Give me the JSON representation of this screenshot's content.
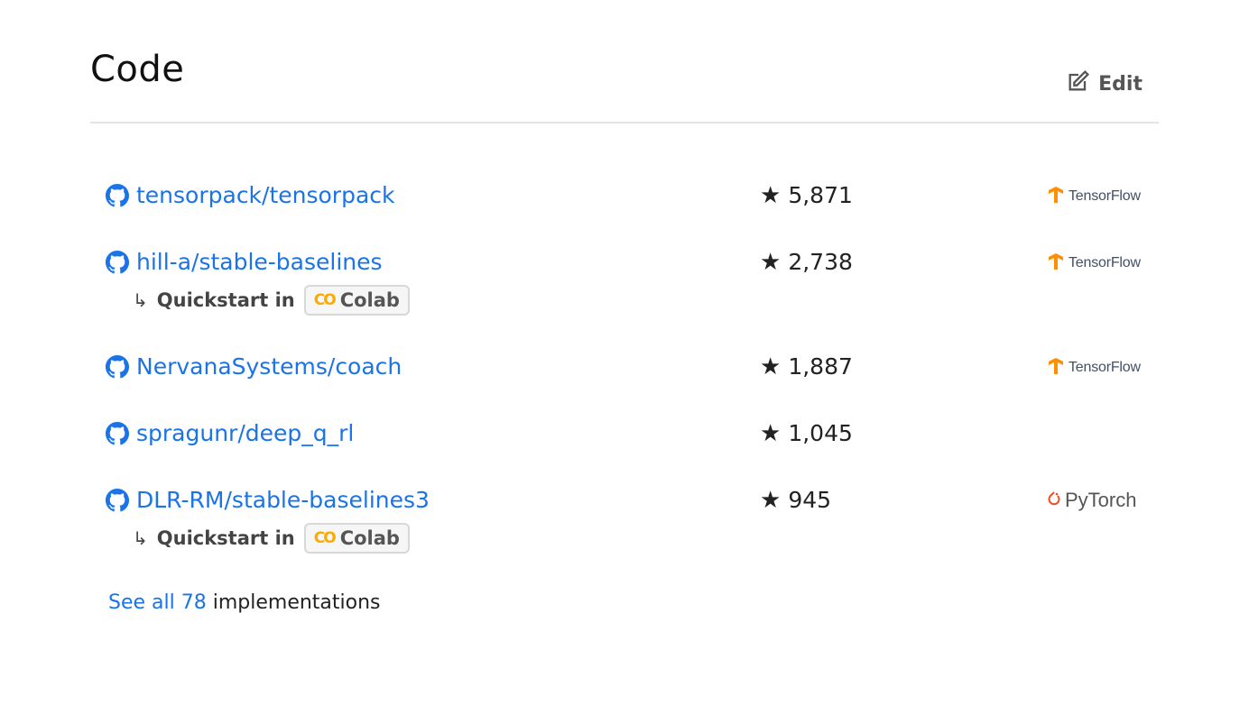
{
  "header": {
    "title": "Code",
    "edit_label": "Edit"
  },
  "rows": [
    {
      "repo": "tensorpack/tensorpack",
      "stars": "5,871",
      "framework": "TensorFlow"
    },
    {
      "repo": "hill-a/stable-baselines",
      "stars": "2,738",
      "framework": "TensorFlow",
      "quickstart": "Quickstart in",
      "colab": "Colab"
    },
    {
      "repo": "NervanaSystems/coach",
      "stars": "1,887",
      "framework": "TensorFlow"
    },
    {
      "repo": "spragunr/deep_q_rl",
      "stars": "1,045",
      "framework": ""
    },
    {
      "repo": "DLR-RM/stable-baselines3",
      "stars": "945",
      "framework": "PyTorch",
      "quickstart": "Quickstart in",
      "colab": "Colab"
    }
  ],
  "footer": {
    "see_all_link": "See all 78",
    "see_all_suffix": "implementations"
  },
  "colors": {
    "link": "#1a73e8",
    "tensorflow": "#ff8f00",
    "pytorch": "#ee4c2c",
    "colab": "#f9ab00"
  }
}
